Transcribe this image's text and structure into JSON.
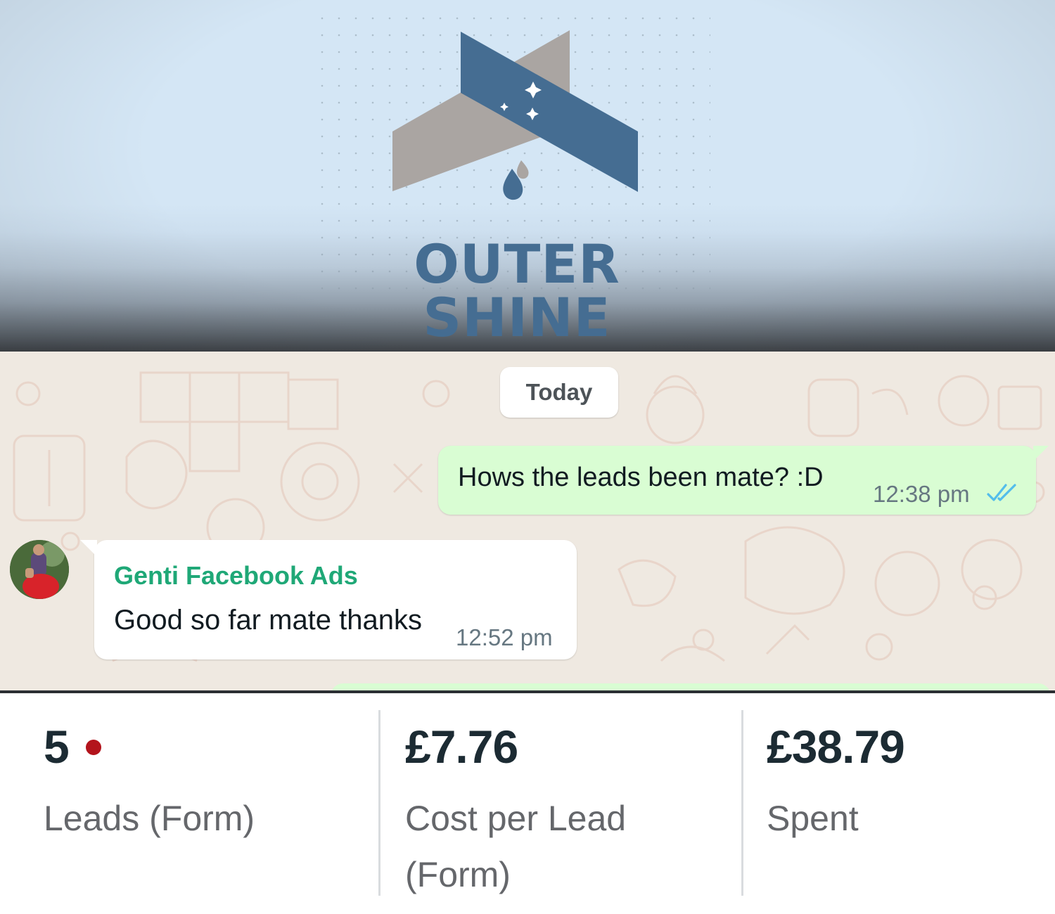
{
  "banner": {
    "brand_name": "OUTER SHINE",
    "colors": {
      "background": "#d4e6f5",
      "logo_blue": "#456d92",
      "logo_gray": "#aaa5a2"
    },
    "icons": [
      "roof-chevron-logo",
      "sparkle-icon",
      "water-drop-icon"
    ]
  },
  "chat": {
    "date_chip": "Today",
    "outgoing": {
      "text": "Hows the leads been mate? :D",
      "time": "12:38 pm",
      "status_icon": "double-check-read-icon"
    },
    "incoming": {
      "sender": "Genti Facebook Ads",
      "text": "Good so far mate thanks",
      "time": "12:52 pm"
    },
    "colors": {
      "outgoing_bubble": "#d9fdd3",
      "incoming_bubble": "#ffffff",
      "sender_name": "#1fa877",
      "read_ticks": "#53bdeb"
    }
  },
  "stats": [
    {
      "value": "5",
      "label": "Leads (Form)",
      "indicator": "red-dot"
    },
    {
      "value": "£7.76",
      "label_line1": "Cost per Lead",
      "label_line2": "(Form)"
    },
    {
      "value": "£38.79",
      "label": "Spent"
    }
  ]
}
